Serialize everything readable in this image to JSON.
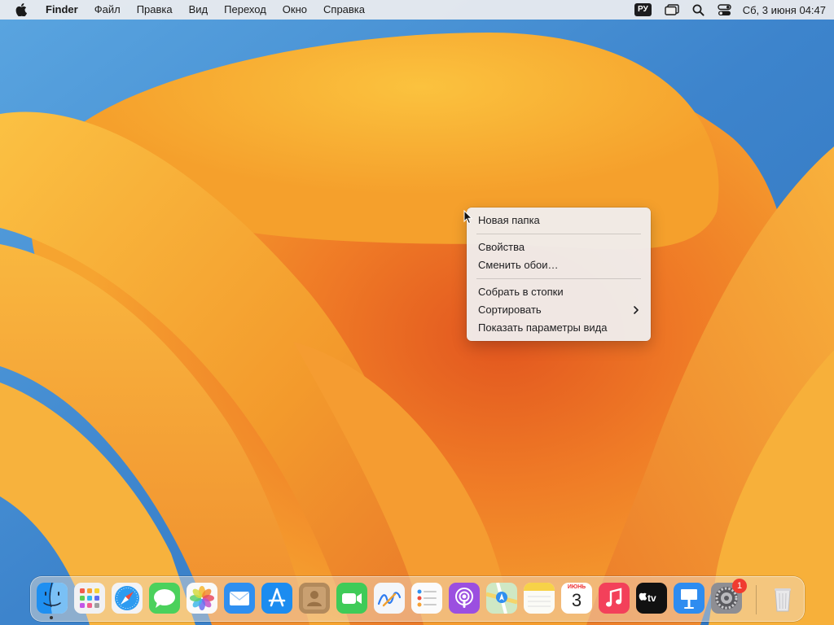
{
  "menubar": {
    "app_name": "Finder",
    "menus": [
      "Файл",
      "Правка",
      "Вид",
      "Переход",
      "Окно",
      "Справка"
    ],
    "input_language": "РУ",
    "clock": "Сб, 3 июня  04:47"
  },
  "context_menu": {
    "items": [
      "Новая папка",
      "Свойства",
      "Сменить обои…",
      "Собрать в стопки",
      "Сортировать",
      "Показать параметры вида"
    ]
  },
  "dock": {
    "apps": [
      "finder",
      "launchpad",
      "safari",
      "messages",
      "photos",
      "mail",
      "app-store",
      "contacts",
      "facetime",
      "freeform",
      "reminders",
      "podcasts",
      "maps",
      "notes",
      "calendar",
      "music",
      "apple-tv",
      "keynote",
      "system-settings",
      "trash"
    ],
    "calendar_month": "ИЮНЬ",
    "calendar_day": "3",
    "settings_badge": "1"
  },
  "colors": {
    "wallpaper_blue": "#3f86cc",
    "wallpaper_orange": "#f5a42a",
    "accent": "#0a84ff"
  }
}
